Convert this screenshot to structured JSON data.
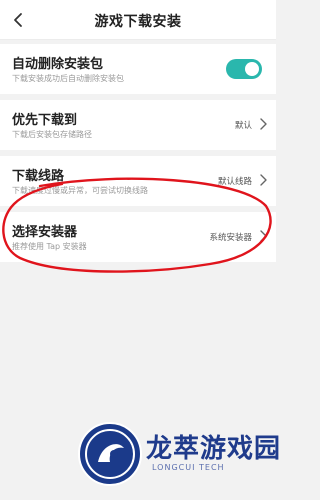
{
  "header": {
    "title": "游戏下载安装"
  },
  "settings": [
    {
      "title": "自动删除安装包",
      "subtitle": "下载安装成功后自动删除安装包",
      "toggle_on": true
    },
    {
      "title": "优先下载到",
      "subtitle": "下载后安装包存储路径",
      "value": "默认"
    },
    {
      "title": "下载线路",
      "subtitle": "下载速度过慢或异常，可尝试切换线路",
      "value": "默认线路"
    },
    {
      "title": "选择安装器",
      "subtitle": "推荐使用 Tap 安装器",
      "value": "系统安装器"
    }
  ],
  "watermark": {
    "text": "龙萃游戏园",
    "sub": "LONGCUI TECH"
  },
  "colors": {
    "accent": "#2ab7ad",
    "annotation": "#e0141c",
    "watermark": "#1f3b8c"
  }
}
